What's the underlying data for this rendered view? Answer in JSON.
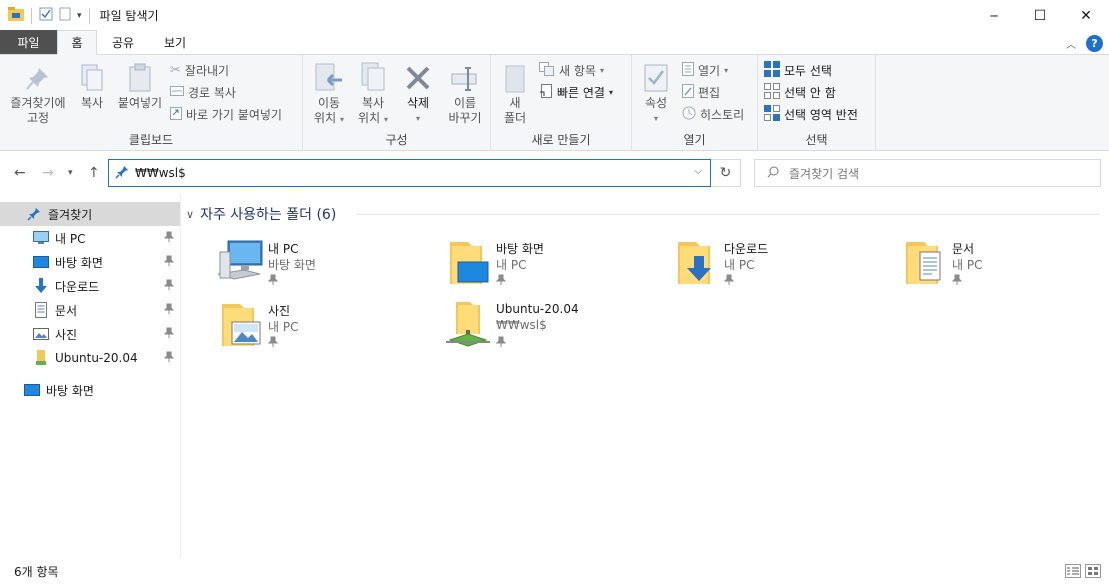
{
  "window": {
    "title": "파일 탐색기",
    "minimize_glyph": "─",
    "maximize_glyph": "☐",
    "close_glyph": "✕"
  },
  "tabs": [
    {
      "label": "파일"
    },
    {
      "label": "홈"
    },
    {
      "label": "공유"
    },
    {
      "label": "보기"
    }
  ],
  "ribbon": {
    "clipboard": {
      "pin_quick_line1": "즐겨찾기에",
      "pin_quick_line2": "고정",
      "copy": "복사",
      "paste": "붙여넣기",
      "cut": "잘라내기",
      "copy_path": "경로 복사",
      "paste_shortcut": "바로 가기 붙여넣기",
      "label": "클립보드"
    },
    "organize": {
      "move_line1": "이동",
      "move_line2": "위치",
      "copy_line1": "복사",
      "copy_line2": "위치",
      "delete": "삭제",
      "rename_line1": "이름",
      "rename_line2": "바꾸기",
      "label": "구성"
    },
    "new": {
      "new_folder_line1": "새",
      "new_folder_line2": "폴더",
      "new_item": "새 항목",
      "easy_access": "빠른 연결",
      "label": "새로 만들기"
    },
    "open": {
      "properties": "속성",
      "open": "열기",
      "edit": "편집",
      "history": "히스토리",
      "label": "열기"
    },
    "select": {
      "select_all": "모두 선택",
      "select_none": "선택 안 함",
      "invert": "선택 영역 반전",
      "label": "선택"
    }
  },
  "address": {
    "path": "₩₩wsl$",
    "search_placeholder": "즐겨찾기 검색"
  },
  "sidebar": {
    "items": [
      {
        "label": "즐겨찾기",
        "icon": "star-icon"
      },
      {
        "label": "내 PC",
        "icon": "computer-icon"
      },
      {
        "label": "바탕 화면",
        "icon": "desktop-icon"
      },
      {
        "label": "다운로드",
        "icon": "download-icon"
      },
      {
        "label": "문서",
        "icon": "document-icon"
      },
      {
        "label": "사진",
        "icon": "picture-icon"
      },
      {
        "label": "Ubuntu-20.04",
        "icon": "linux-folder-icon"
      },
      {
        "label": "바탕 화면",
        "icon": "desktop-icon"
      }
    ]
  },
  "content": {
    "section_title": "자주 사용하는 폴더 (6)",
    "tiles": [
      {
        "name": "내 PC",
        "sub": "바탕 화면"
      },
      {
        "name": "바탕 화면",
        "sub": "내 PC"
      },
      {
        "name": "다운로드",
        "sub": "내 PC"
      },
      {
        "name": "문서",
        "sub": "내 PC"
      },
      {
        "name": "사진",
        "sub": "내 PC"
      },
      {
        "name": "Ubuntu-20.04",
        "sub": "₩₩wsl$"
      }
    ]
  },
  "status": {
    "count": "6개 항목"
  },
  "colors": {
    "accent": "#1a73c9",
    "folder": "#f3c75a",
    "file_tab": "#505050"
  }
}
